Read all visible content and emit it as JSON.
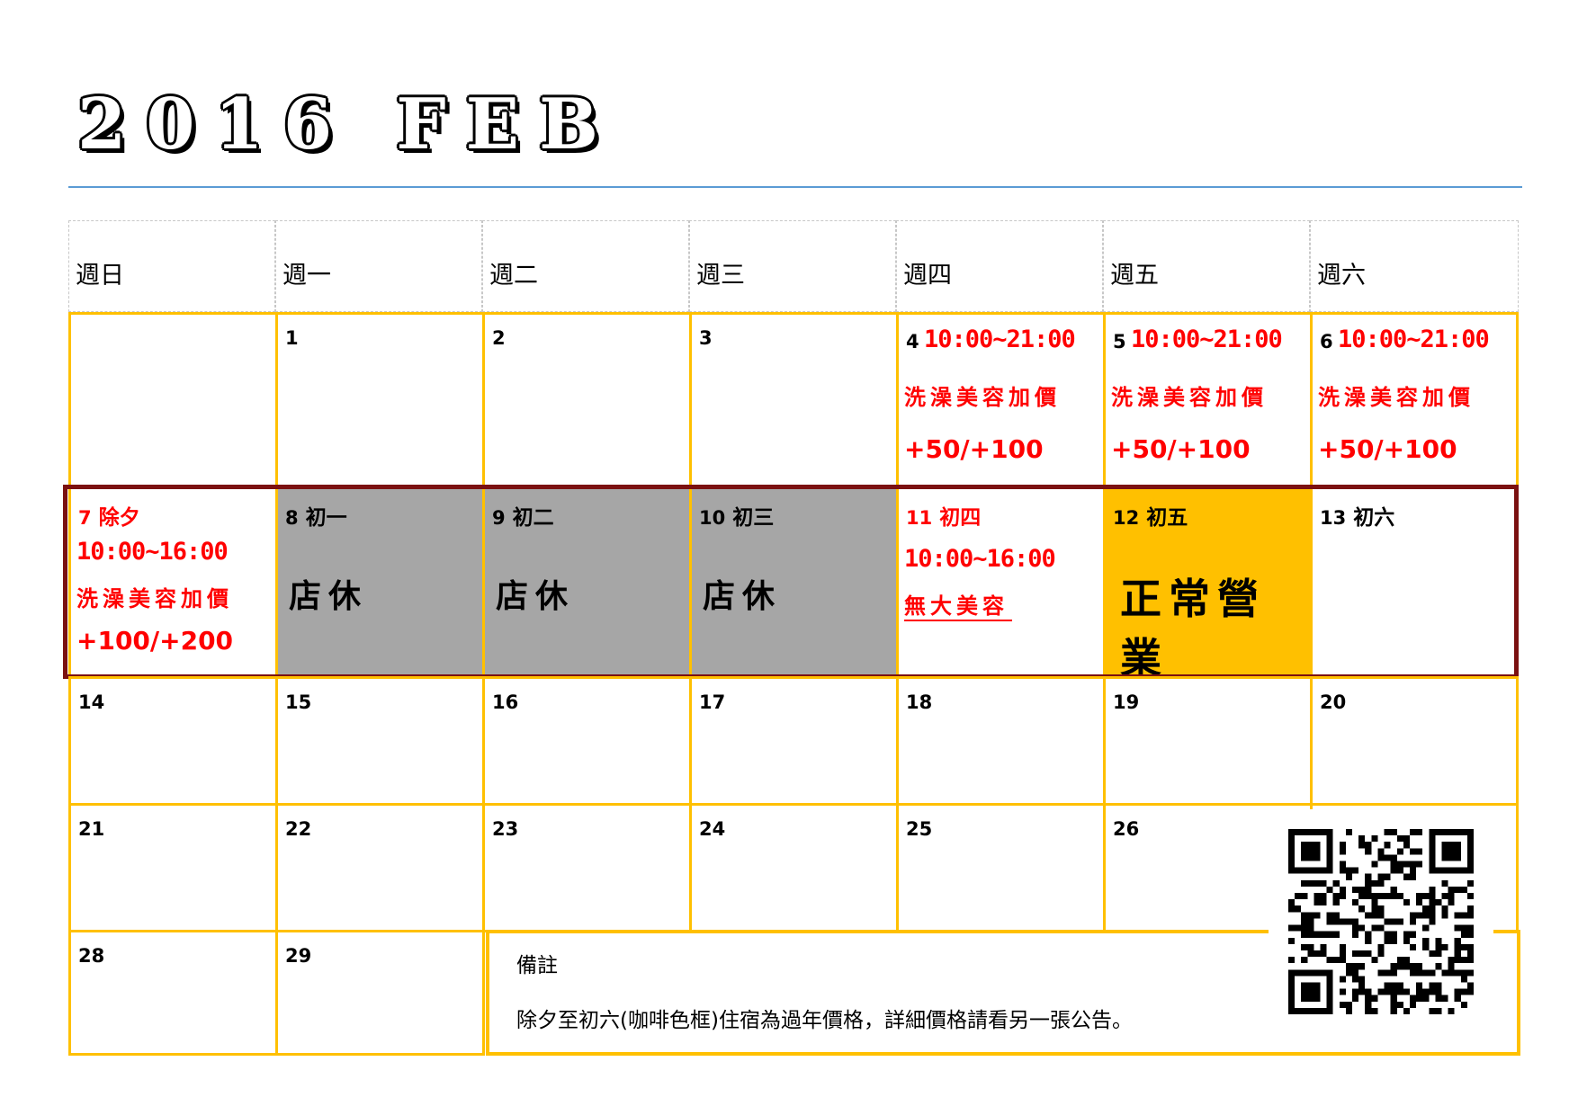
{
  "title": "2016 FEB",
  "weekdays": [
    "週日",
    "週一",
    "週二",
    "週三",
    "週四",
    "週五",
    "週六"
  ],
  "days": {
    "d1": "1",
    "d2": "2",
    "d3": "3",
    "d4": "4",
    "d5": "5",
    "d6": "6",
    "d7": "7",
    "d8": "8",
    "d9": "9",
    "d10": "10",
    "d11": "11",
    "d12": "12",
    "d13": "13",
    "d14": "14",
    "d15": "15",
    "d16": "16",
    "d17": "17",
    "d18": "18",
    "d19": "19",
    "d20": "20",
    "d21": "21",
    "d22": "22",
    "d23": "23",
    "d24": "24",
    "d25": "25",
    "d26": "26",
    "d28": "28",
    "d29": "29"
  },
  "lunar": {
    "d7": "除夕",
    "d8": "初一",
    "d9": "初二",
    "d10": "初三",
    "d11": "初四",
    "d12": "初五",
    "d13": "初六"
  },
  "notes": {
    "hours_thu_sat": "10:00~21:00",
    "bath_surcharge": "洗澡美容加價",
    "price_thu_sat": "+50/+100",
    "hours_eve": "10:00~16:00",
    "price_eve": "+100/+200",
    "hours_d11": "10:00~16:00",
    "no_large_grooming": "無大美容",
    "closed": "店休",
    "normal_business": "正常營業"
  },
  "remarks": {
    "title": "備註",
    "body": "除夕至初六(咖啡色框)住宿為過年價格，詳細價格請看另一張公告。"
  },
  "colors": {
    "grid": "#ffc000",
    "closed_bg": "#a6a6a6",
    "open_bg": "#ffc000",
    "new_year_frame": "#7b1111",
    "note_red": "#ff0000",
    "rule": "#5b9bd5"
  },
  "qr_code": "qr-code-icon"
}
